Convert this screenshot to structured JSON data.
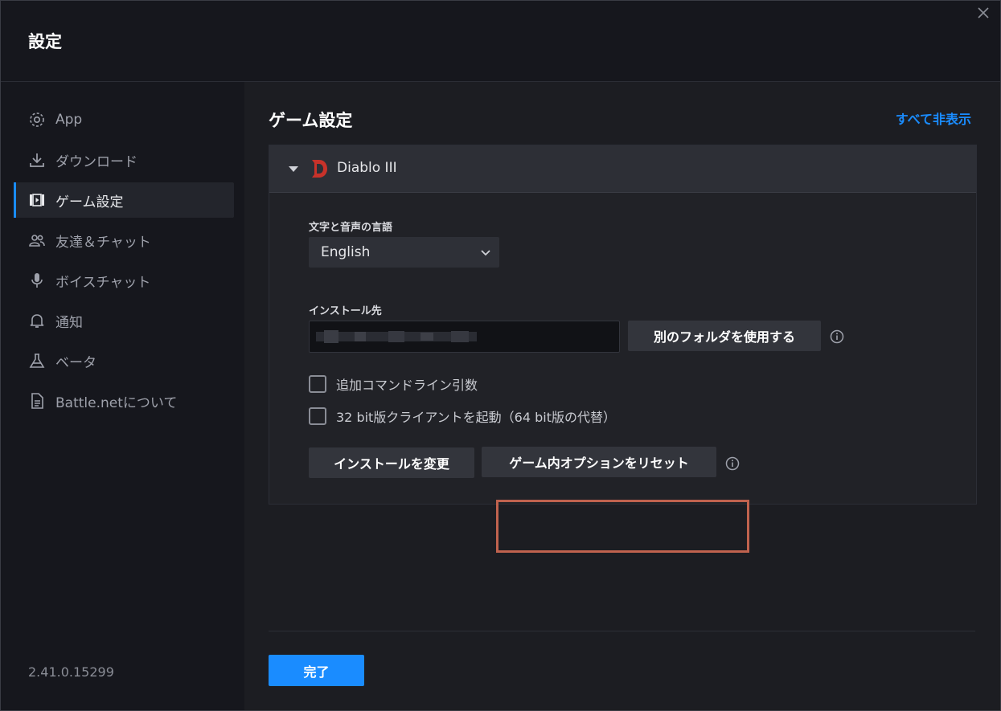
{
  "window": {
    "title": "設定"
  },
  "sidebar": {
    "items": [
      {
        "label": "App",
        "icon": "gear-icon"
      },
      {
        "label": "ダウンロード",
        "icon": "download-icon"
      },
      {
        "label": "ゲーム設定",
        "icon": "game-settings-icon",
        "active": true
      },
      {
        "label": "友達＆チャット",
        "icon": "friends-icon"
      },
      {
        "label": "ボイスチャット",
        "icon": "microphone-icon"
      },
      {
        "label": "通知",
        "icon": "bell-icon"
      },
      {
        "label": "ベータ",
        "icon": "flask-icon"
      },
      {
        "label": "Battle.netについて",
        "icon": "document-icon"
      }
    ],
    "version": "2.41.0.15299"
  },
  "main": {
    "title": "ゲーム設定",
    "hide_all": "すべて非表示",
    "game": {
      "name": "Diablo III",
      "language_label": "文字と音声の言語",
      "language_value": "English",
      "install_label": "インストール先",
      "other_folder_button": "別のフォルダを使用する",
      "checkbox_cmd": "追加コマンドライン引数",
      "checkbox_32bit": "32 bit版クライアントを起動（64 bit版の代替）",
      "change_install_button": "インストールを変更",
      "reset_options_button": "ゲーム内オプションをリセット"
    },
    "done_button": "完了"
  },
  "colors": {
    "accent": "#1a8cff",
    "highlight": "#c0624e",
    "game_logo": "#c8322a"
  }
}
